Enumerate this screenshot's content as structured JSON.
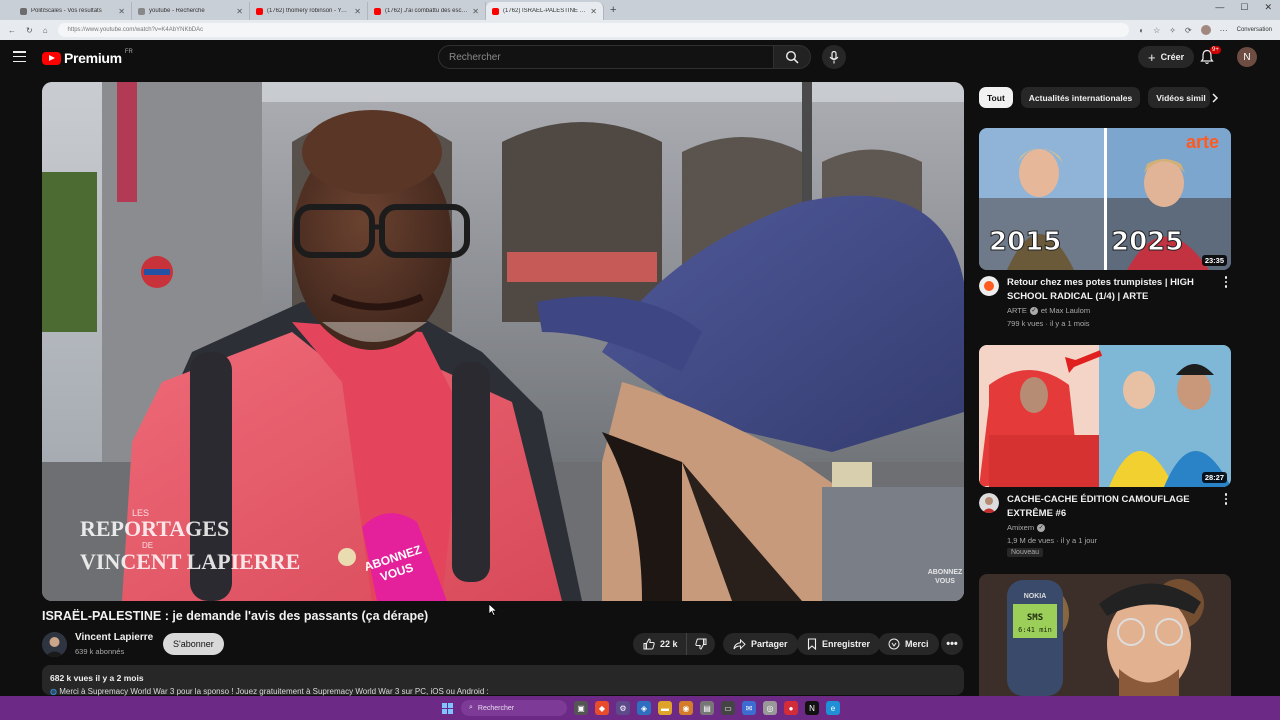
{
  "browser": {
    "tabs": [
      {
        "label": "PolitiScales - Vos résultats",
        "color": "#6c6c6c",
        "active": false
      },
      {
        "label": "youtube - Recherche",
        "color": "#888888",
        "active": false
      },
      {
        "label": "(1762) thomery robinson - YouTube",
        "color": "#ff0000",
        "active": false
      },
      {
        "label": "(1762) J'ai combattu des escrocs",
        "color": "#ff0000",
        "active": false
      },
      {
        "label": "(1762) ISRAËL-PALESTINE : je dem",
        "color": "#ff0000",
        "active": true
      }
    ],
    "new_tab": "+",
    "url": "https://www.youtube.com/watch?v=K4AbYNKbDAc",
    "profile_label": "Conversation"
  },
  "header": {
    "logo_text": "Premium",
    "logo_sup": "FR",
    "search_placeholder": "Rechercher",
    "create_label": "Créer",
    "notif_count": "9+",
    "avatar_letter": "N"
  },
  "video": {
    "title": "ISRAËL-PALESTINE : je demande l'avis des passants (ça dérape)",
    "overlay_brand_top": "LES",
    "overlay_brand_1": "REPORTAGES",
    "overlay_brand_de": "DE",
    "overlay_brand_2": "VINCENT LAPIERRE",
    "mic_text_1": "ABONNEZ",
    "mic_text_2": "VOUS",
    "watermark_1": "ABONNEZ",
    "watermark_2": "VOUS",
    "channel_name": "Vincent Lapierre",
    "channel_subs": "639 k abonnés",
    "subscribe_label": "S'abonner",
    "likes": "22 k",
    "share_label": "Partager",
    "save_label": "Enregistrer",
    "thanks_label": "Merci",
    "views_date": "682 k vues  il y a 2 mois",
    "description_line": "Merci à Supremacy World War 3 pour la sponso ! Jouez gratuitement à Supremacy World War 3 sur PC, iOS ou Android :"
  },
  "sidebar": {
    "chips": [
      "Tout",
      "Actualités internationales",
      "Vidéos simil"
    ],
    "cards": [
      {
        "title": "Retour chez mes potes trumpistes | HIGH SCHOOL RADICAL (1/4) | ARTE",
        "channel": "ARTE",
        "channel_extra": "et Max Laulom",
        "meta": "799 k vues · il y a 1 mois",
        "duration": "23:35",
        "thumb_text_1": "2015",
        "thumb_text_2": "2025",
        "thumb_brand": "arte",
        "badge": ""
      },
      {
        "title": "CACHE-CACHE ÉDITION CAMOUFLAGE EXTRÊME #6",
        "channel": "Amixem",
        "channel_extra": "",
        "meta": "1,9 M de vues · il y a 1 jour",
        "duration": "28:27",
        "badge": "Nouveau"
      },
      {
        "title": "",
        "channel": "",
        "meta": "",
        "duration": "",
        "phone_text": "SMS",
        "phone_time": "6:41 min",
        "phone_brand": "NOKIA",
        "badge": ""
      }
    ]
  },
  "taskbar": {
    "search_placeholder": "Rechercher"
  },
  "colors": {
    "background": "#0f0f0f",
    "brand_red": "#ff0000",
    "taskbar": "#6c2a86"
  }
}
